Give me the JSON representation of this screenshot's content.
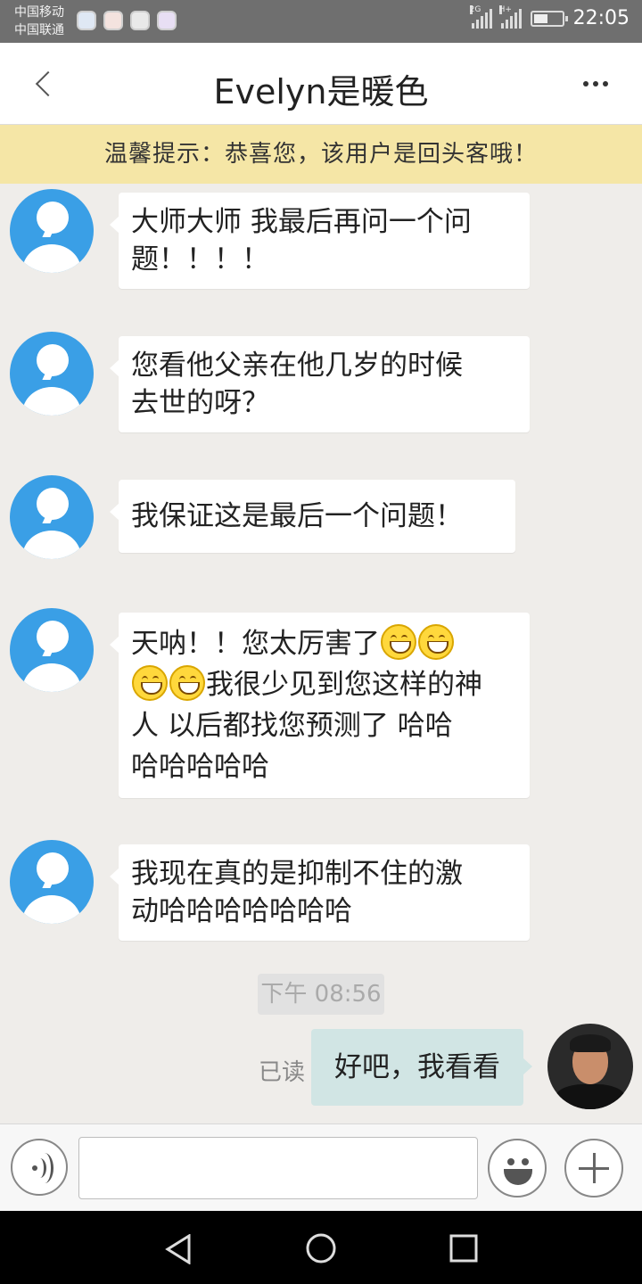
{
  "status_bar": {
    "carrier_1": "中国移动",
    "carrier_2": "中国联通",
    "network_1": "2G",
    "network_2": "H+",
    "time": "22:05",
    "battery_level": 0.5,
    "icons": [
      "weibo-app-icon",
      "browser-app-icon",
      "shield-app-icon",
      "gallery-app-icon"
    ]
  },
  "header": {
    "title": "Evelyn是暖色",
    "back_icon": "chevron-left-icon",
    "more_icon": "more-dots-icon"
  },
  "notice": {
    "text": "温馨提示：恭喜您，该用户是回头客哦！",
    "background_color": "#f5e6a6"
  },
  "messages": {
    "m1": {
      "line1": "大师大师 我最后再问一个问",
      "line2": "题！！！！"
    },
    "m2": {
      "line1": "您看他父亲在他几岁的时候",
      "line2": "去世的呀？"
    },
    "m3": {
      "line1": "我保证这是最后一个问题！"
    },
    "m4": {
      "part1": "天呐！！您太厉害了",
      "part2": "我很少见到您这样的神",
      "line3": "人 以后都找您预测了 哈哈",
      "line4": "哈哈哈哈哈",
      "emoji": "smile-emoji-icon"
    },
    "m5": {
      "line1": "我现在真的是抑制不住的激",
      "line2": "动哈哈哈哈哈哈哈"
    },
    "timestamp": "下午 08:56",
    "outgoing": {
      "text": "好吧，我看看",
      "status": "已读"
    }
  },
  "input_bar": {
    "voice_icon": "voice-icon",
    "emoji_icon": "emoji-icon",
    "plus_icon": "plus-icon",
    "placeholder": ""
  },
  "colors": {
    "incoming_avatar": "#3a9fe6",
    "outgoing_bubble": "#d1e5e4",
    "chat_background": "#efedea"
  }
}
